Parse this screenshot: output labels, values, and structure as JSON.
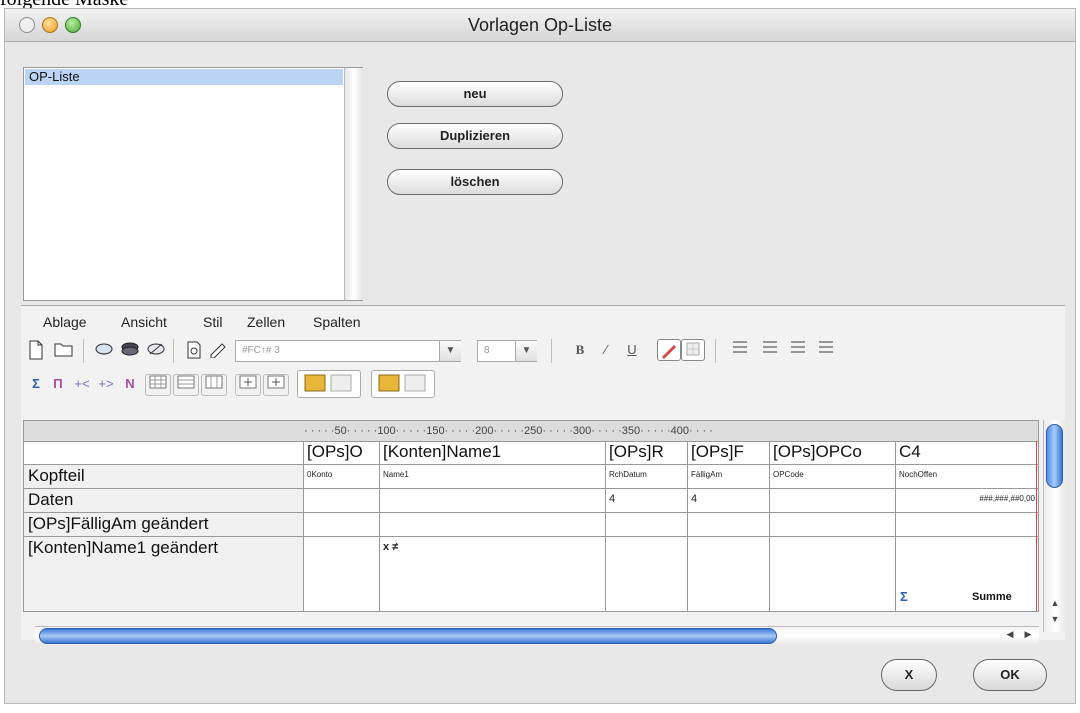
{
  "caption": "folgende Maske",
  "window": {
    "title": "Vorlagen Op-Liste"
  },
  "list": {
    "items": [
      "OP-Liste"
    ]
  },
  "actions": {
    "new_label": "neu",
    "duplicate_label": "Duplizieren",
    "delete_label": "löschen"
  },
  "editor": {
    "menu": [
      "Ablage",
      "Ansicht",
      "Stil",
      "Zellen",
      "Spalten"
    ],
    "toolbar": {
      "font_placeholder": "#FC↑# 3",
      "size_value": "8",
      "bold_label": "B",
      "italic_label": "∕",
      "underline_label": "U"
    },
    "ruler": "· · · · ·50· · · · ·100· · · · ·150· · · · ·200· · · · ·250· · · · ·300· · · · ·350· · · · ·400· · · ·",
    "columns": [
      "",
      "[OPs]O",
      "[Konten]Name1",
      "[OPs]R",
      "[OPs]F",
      "[OPs]OPCo",
      "C4"
    ],
    "rows": [
      {
        "label": "Kopfteil",
        "cells": [
          "0Konto",
          "Name1",
          "RchDatum",
          "FälligAm",
          "OPCode",
          "NochOffen"
        ]
      },
      {
        "label": "Daten",
        "cells": [
          "",
          "",
          "4",
          "4",
          "",
          "###,###,##0,00"
        ]
      },
      {
        "label": "[OPs]FälligAm geändert",
        "cells": [
          "",
          "",
          "",
          "",
          "",
          ""
        ]
      },
      {
        "label": "[Konten]Name1 geändert",
        "cells": [
          "",
          "x ≠",
          "",
          "",
          "",
          "Summe"
        ]
      }
    ]
  },
  "footer": {
    "cancel_label": "X",
    "ok_label": "OK"
  },
  "colors": {
    "selection": "#bcd4f4",
    "scroll_blue": "#4f8ee8",
    "break_line": "#e04040"
  }
}
